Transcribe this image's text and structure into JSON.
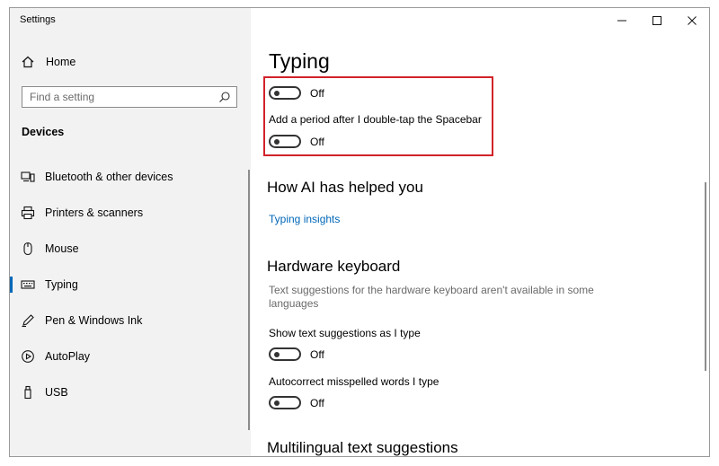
{
  "window": {
    "title": "Settings"
  },
  "sidebar": {
    "home_label": "Home",
    "search_placeholder": "Find a setting",
    "section_title": "Devices",
    "items": [
      {
        "label": "Bluetooth & other devices",
        "icon": "bluetooth-devices-icon"
      },
      {
        "label": "Printers & scanners",
        "icon": "printer-icon"
      },
      {
        "label": "Mouse",
        "icon": "mouse-icon"
      },
      {
        "label": "Typing",
        "icon": "keyboard-icon",
        "active": true
      },
      {
        "label": "Pen & Windows Ink",
        "icon": "pen-icon"
      },
      {
        "label": "AutoPlay",
        "icon": "autoplay-icon"
      },
      {
        "label": "USB",
        "icon": "usb-icon"
      }
    ]
  },
  "main": {
    "page_title": "Typing",
    "toggle_top": {
      "state_label": "Off",
      "on": false
    },
    "period_setting": {
      "label": "Add a period after I double-tap the Spacebar",
      "state_label": "Off",
      "on": false
    },
    "ai_section": {
      "heading": "How AI has helped you",
      "link": "Typing insights"
    },
    "hardware_section": {
      "heading": "Hardware keyboard",
      "description": "Text suggestions for the hardware keyboard aren't available in some languages",
      "suggestions": {
        "label": "Show text suggestions as I type",
        "state_label": "Off",
        "on": false
      },
      "autocorrect": {
        "label": "Autocorrect misspelled words I type",
        "state_label": "Off",
        "on": false
      }
    },
    "multilingual_section": {
      "heading": "Multilingual text suggestions"
    }
  },
  "colors": {
    "accent": "#0067b8",
    "highlight": "#d2232a",
    "sidebar_bg": "#f2f2f2"
  }
}
